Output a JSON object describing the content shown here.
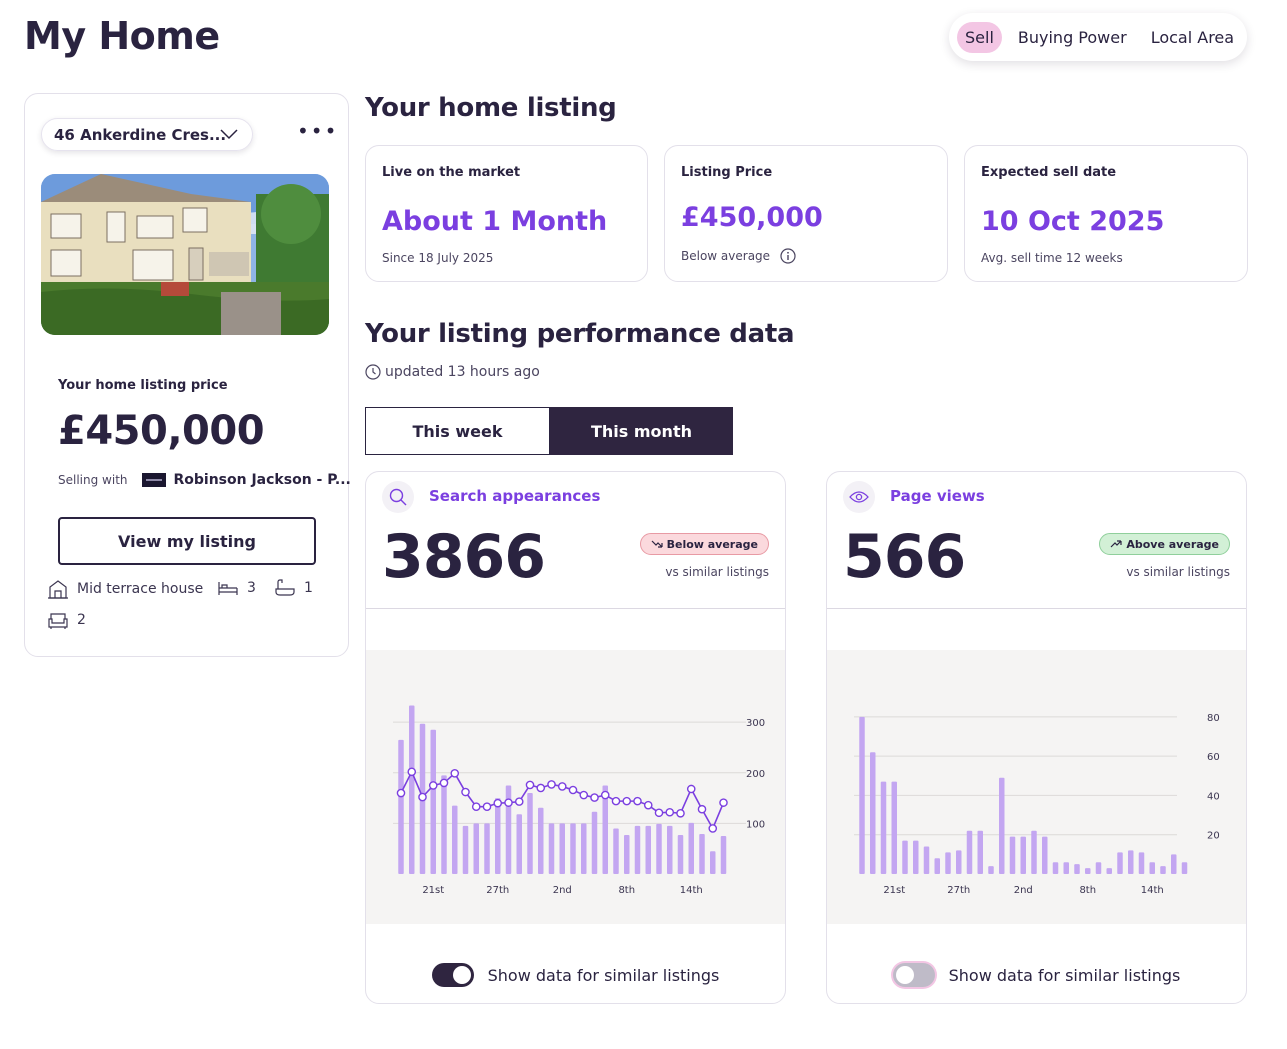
{
  "page": {
    "title": "My Home"
  },
  "nav": {
    "items": [
      "Sell",
      "Buying Power",
      "Local Area"
    ],
    "active": "Sell"
  },
  "property": {
    "address": "46 Ankerdine Cres...",
    "price_label": "Your home listing price",
    "price": "£450,000",
    "selling_with_label": "Selling with",
    "agent": "Robinson Jackson - P...",
    "view_button": "View my listing",
    "type": "Mid terrace house",
    "bedrooms": "3",
    "bathrooms": "1",
    "receptions": "2"
  },
  "listing": {
    "heading": "Your home listing",
    "cards": [
      {
        "label": "Live on the market",
        "value": "About 1 Month",
        "sub": "Since 18 July 2025"
      },
      {
        "label": "Listing Price",
        "value": "£450,000",
        "sub": "Below average"
      },
      {
        "label": "Expected sell date",
        "value": "10 Oct 2025",
        "sub": "Avg. sell time 12 weeks"
      }
    ]
  },
  "performance": {
    "heading": "Your listing performance data",
    "updated": "updated 13 hours ago",
    "tabs": [
      "This week",
      "This month"
    ],
    "active_tab": "This month",
    "toggle_label": "Show data for similar listings"
  },
  "metrics": [
    {
      "title": "Search appearances",
      "value": "3866",
      "badge": "Below average",
      "badge_status": "below",
      "vs": "vs similar listings",
      "show_similar": true
    },
    {
      "title": "Page views",
      "value": "566",
      "badge": "Above average",
      "badge_status": "above",
      "vs": "vs similar listings",
      "show_similar": false
    }
  ],
  "colors": {
    "accent": "#7b3fe0",
    "bar": "#c3a6f1",
    "dark": "#2a2340",
    "below_bg": "#fbd9dd",
    "above_bg": "#d2f0d6"
  },
  "chart_data": [
    {
      "type": "bar",
      "title": "Search appearances",
      "x_tick_labels": [
        "21st",
        "27th",
        "2nd",
        "8th",
        "14th"
      ],
      "y_tick_labels": [
        "100",
        "200",
        "300"
      ],
      "ylim": [
        0,
        330
      ],
      "grid": true,
      "series": [
        {
          "values": [
            265,
            333,
            297,
            285,
            195,
            135,
            95,
            100,
            100,
            150,
            175,
            118,
            160,
            131,
            100,
            100,
            100,
            100,
            123,
            175,
            90,
            77,
            95,
            95,
            99,
            95,
            77,
            101,
            79,
            45,
            75
          ]
        },
        {
          "type": "line",
          "values": [
            160,
            202,
            152,
            175,
            180,
            199,
            162,
            133,
            133,
            140,
            141,
            143,
            176,
            170,
            177,
            173,
            166,
            156,
            151,
            156,
            144,
            144,
            144,
            136,
            121,
            122,
            120,
            168,
            128,
            90,
            141
          ]
        }
      ]
    },
    {
      "type": "bar",
      "title": "Page views",
      "x_tick_labels": [
        "21st",
        "27th",
        "2nd",
        "8th",
        "14th"
      ],
      "y_tick_labels": [
        "20",
        "40",
        "60",
        "80"
      ],
      "ylim": [
        0,
        85
      ],
      "grid": true,
      "series": [
        {
          "values": [
            80,
            62,
            47,
            47,
            17,
            17,
            14,
            8,
            11,
            12,
            22,
            22,
            4,
            49,
            19,
            19,
            22,
            19,
            6,
            6,
            5,
            3,
            6,
            3,
            11,
            12,
            11,
            6,
            4,
            10,
            6
          ]
        }
      ]
    }
  ]
}
